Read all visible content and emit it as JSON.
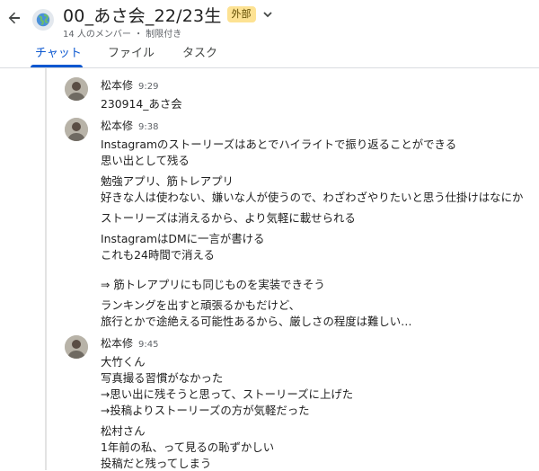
{
  "header": {
    "title": "00_あさ会_22/23生",
    "badge": "外部",
    "subtitle": "14 人のメンバー ・ 制限付き"
  },
  "tabs": [
    {
      "label": "チャット",
      "active": true
    },
    {
      "label": "ファイル",
      "active": false
    },
    {
      "label": "タスク",
      "active": false
    }
  ],
  "messages": [
    {
      "sender": "松本修",
      "time": "9:29",
      "lines": [
        "230914_あさ会"
      ]
    },
    {
      "sender": "松本修",
      "time": "9:38",
      "lines": [
        "Instagramのストーリーズはあとでハイライトで振り返ることができる",
        "思い出として残る",
        "勉強アプリ、筋トレアプリ",
        "好きな人は使わない、嫌いな人が使うので、わざわざやりたいと思う仕掛けはなにか",
        "ストーリーズは消えるから、より気軽に載せられる",
        "InstagramはDMに一言が書ける",
        "これも24時間で消える",
        "⇒ 筋トレアプリにも同じものを実装できそう",
        "ランキングを出すと頑張るかもだけど、",
        "旅行とかで途絶える可能性あるから、厳しさの程度は難しい…"
      ]
    },
    {
      "sender": "松本修",
      "time": "9:45",
      "lines": [
        "大竹くん",
        "写真撮る習慣がなかった",
        "→思い出に残そうと思って、ストーリーズに上げた",
        "→投稿よりストーリーズの方が気軽だった",
        "松村さん",
        "1年前の私、って見るの恥ずかしい",
        "投稿だと残ってしまう"
      ]
    }
  ]
}
